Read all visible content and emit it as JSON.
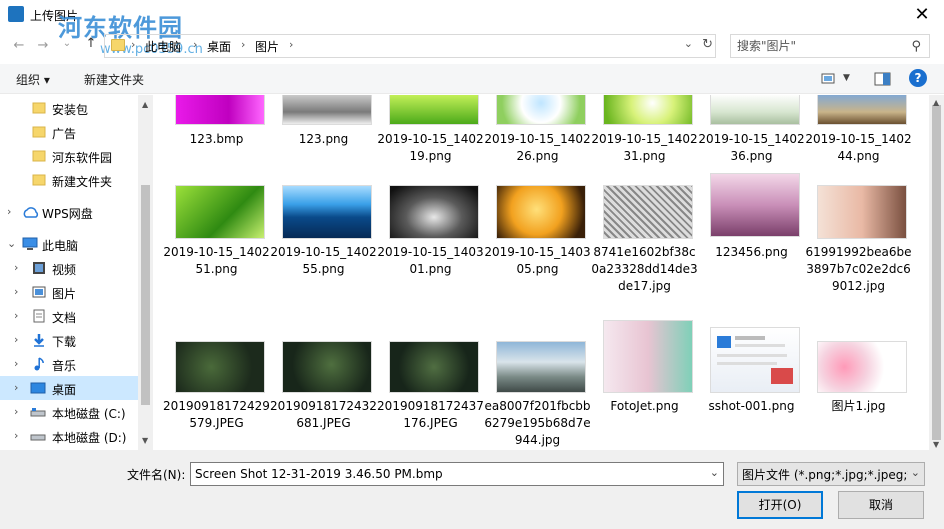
{
  "window": {
    "title": "上传图片",
    "watermark": "河东软件园",
    "watermark_url": "www.pc0359.cn"
  },
  "address": {
    "breadcrumbs": [
      "此电脑",
      "桌面",
      "图片"
    ]
  },
  "search": {
    "placeholder": "搜索\"图片\""
  },
  "toolbar": {
    "organize": "组织 ▾",
    "new_folder": "新建文件夹"
  },
  "nav": {
    "items": [
      {
        "label": "安装包",
        "icon": "folder-icon"
      },
      {
        "label": "广告",
        "icon": "folder-icon"
      },
      {
        "label": "河东软件园",
        "icon": "folder-icon"
      },
      {
        "label": "新建文件夹",
        "icon": "folder-icon"
      },
      {
        "label": "WPS网盘",
        "icon": "cloud-icon"
      },
      {
        "label": "此电脑",
        "icon": "computer-icon"
      },
      {
        "label": "视频",
        "icon": "video-icon"
      },
      {
        "label": "图片",
        "icon": "pictures-icon"
      },
      {
        "label": "文档",
        "icon": "document-icon"
      },
      {
        "label": "下载",
        "icon": "download-icon"
      },
      {
        "label": "音乐",
        "icon": "music-icon"
      },
      {
        "label": "桌面",
        "icon": "desktop-icon"
      },
      {
        "label": "本地磁盘 (C:)",
        "icon": "drive-icon"
      },
      {
        "label": "本地磁盘 (D:)",
        "icon": "drive-icon"
      }
    ]
  },
  "files": [
    {
      "name": "123.bmp"
    },
    {
      "name": "123.png"
    },
    {
      "name": "2019-10-15_140219.png"
    },
    {
      "name": "2019-10-15_140226.png"
    },
    {
      "name": "2019-10-15_140231.png"
    },
    {
      "name": "2019-10-15_140236.png"
    },
    {
      "name": "2019-10-15_140244.png"
    },
    {
      "name": "2019-10-15_140251.png"
    },
    {
      "name": "2019-10-15_140255.png"
    },
    {
      "name": "2019-10-15_140301.png"
    },
    {
      "name": "2019-10-15_140305.png"
    },
    {
      "name": "8741e1602bf38c0a23328dd14de3de17.jpg"
    },
    {
      "name": "123456.png"
    },
    {
      "name": "61991992bea6be3897b7c02e2dc69012.jpg"
    },
    {
      "name": "20190918172429579.JPEG"
    },
    {
      "name": "20190918172432681.JPEG"
    },
    {
      "name": "20190918172437176.JPEG"
    },
    {
      "name": "ea8007f201fbcbb6279e195b68d7e944.jpg"
    },
    {
      "name": "FotoJet.png"
    },
    {
      "name": "sshot-001.png"
    },
    {
      "name": "图片1.jpg"
    }
  ],
  "footer": {
    "filename_label": "文件名(N):",
    "filename_value": "Screen Shot 12-31-2019 3.46.50 PM.bmp",
    "filetype": "图片文件 (*.png;*.jpg;*.jpeg;*.",
    "open": "打开(O)",
    "cancel": "取消"
  },
  "colors": {
    "accent": "#0078d7",
    "selection": "#cce8ff",
    "help": "#1a6fcf"
  }
}
